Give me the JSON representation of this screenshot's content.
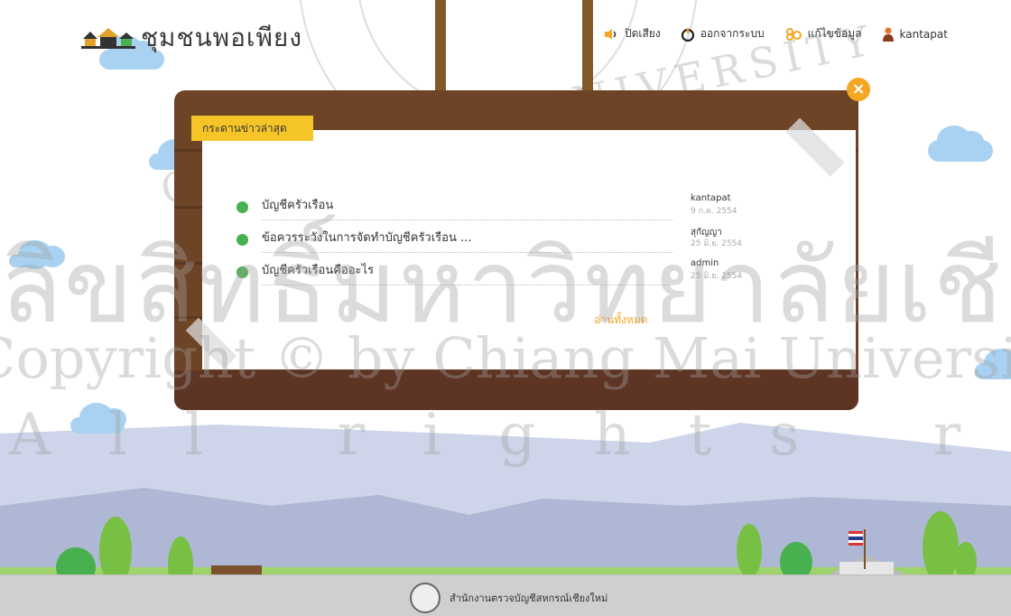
{
  "header": {
    "title": "ชุมชนพอเพียง",
    "nav": [
      {
        "label": "ปิดเสียง",
        "icon": "speaker-icon"
      },
      {
        "label": "ออกจากระบบ",
        "icon": "power-icon"
      },
      {
        "label": "แก้ไขข้อมูล",
        "icon": "edit-profile-icon"
      },
      {
        "label": "kantapat",
        "icon": "user-icon"
      }
    ]
  },
  "board": {
    "tab_label": "กระดานข่าวล่าสุด",
    "read_all": "อ่านทั้งหมด",
    "posts": [
      {
        "title": "บัญชีครัวเรือน",
        "author": "kantapat",
        "date": "9 ก.ค. 2554"
      },
      {
        "title": "ข้อควรระวังในการจัดทำบัญชีครัวเรือน ...",
        "author": "สุกัญญา",
        "date": "25 มิ.ย. 2554"
      },
      {
        "title": "บัญชีครัวเรือนคืออะไร",
        "author": "admin",
        "date": "25 มิ.ย. 2554"
      }
    ]
  },
  "footer": {
    "text": "สำนักงานตรวจบัญชีสหกรณ์เชียงใหม่"
  },
  "watermark": {
    "line1": "ลิขสิทธิ์มหาวิทยาลัยเชียงใหม่",
    "line2": "Copyright © by Chiang Mai University",
    "line3": "All rights reserved",
    "seal": "CHIANG MAI UNIVERSITY"
  },
  "colors": {
    "accent": "#f5c528",
    "close": "#f5a623",
    "wood": "#6e4426",
    "bullet": "#48b04e"
  }
}
